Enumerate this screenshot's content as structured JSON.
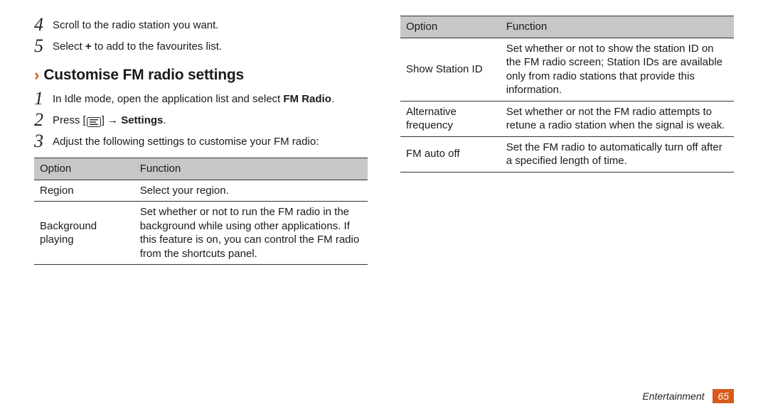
{
  "steps_prev": [
    {
      "n": "4",
      "text": "Scroll to the radio station you want."
    },
    {
      "n": "5",
      "prefix": "Select ",
      "plus": "+",
      "suffix": " to add to the favourites list."
    }
  ],
  "section": {
    "title": "Customise FM radio settings"
  },
  "steps_section": [
    {
      "n": "1",
      "text_before": "In Idle mode, open the application list and select ",
      "bold1": "FM Radio",
      "text_after": "."
    },
    {
      "n": "2",
      "text_before": "Press [",
      "icon": true,
      "text_mid": "] → ",
      "bold1": "Settings",
      "text_after": "."
    },
    {
      "n": "3",
      "text_before": "Adjust the following settings to customise your FM radio:",
      "bold1": "",
      "text_after": ""
    }
  ],
  "table_headers": {
    "option": "Option",
    "function": "Function"
  },
  "table_left": [
    {
      "option": "Region",
      "function": "Select your region."
    },
    {
      "option": "Background playing",
      "function": "Set whether or not to run the FM radio in the background while using other applications. If this feature is on, you can control the FM radio from the shortcuts panel."
    }
  ],
  "table_right": [
    {
      "option": "Show Station ID",
      "function": "Set whether or not to show the station ID on the FM radio screen; Station IDs are available only from radio stations that provide this information."
    },
    {
      "option": "Alternative frequency",
      "function": "Set whether or not the FM radio attempts to retune a radio station when the signal is weak."
    },
    {
      "option": "FM auto off",
      "function": "Set the FM radio to automatically turn off after a specified length of time."
    }
  ],
  "footer": {
    "section": "Entertainment",
    "page": "65"
  }
}
